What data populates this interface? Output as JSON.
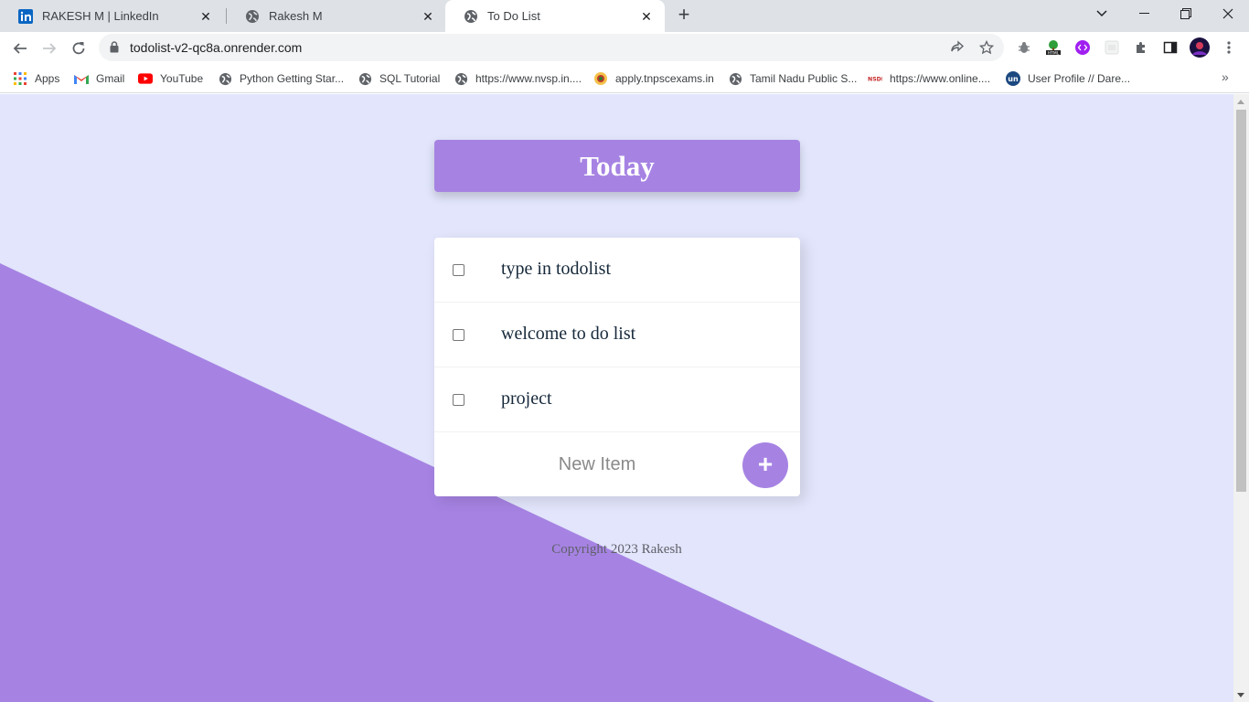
{
  "browser": {
    "tabs": [
      {
        "label": "RAKESH M | LinkedIn",
        "icon": "linkedin-icon"
      },
      {
        "label": "Rakesh M",
        "icon": "globe-icon"
      },
      {
        "label": "To Do List",
        "icon": "globe-icon",
        "active": true
      }
    ],
    "address": "todolist-v2-qc8a.onrender.com",
    "bookmarks": [
      {
        "label": "Apps",
        "icon": "apps-grid-icon"
      },
      {
        "label": "Gmail",
        "icon": "gmail-icon"
      },
      {
        "label": "YouTube",
        "icon": "youtube-icon"
      },
      {
        "label": "Python Getting Star...",
        "icon": "globe-icon"
      },
      {
        "label": "SQL Tutorial",
        "icon": "globe-icon"
      },
      {
        "label": "https://www.nvsp.in....",
        "icon": "globe-icon"
      },
      {
        "label": "apply.tnpscexams.in",
        "icon": "emblem-icon"
      },
      {
        "label": "Tamil Nadu Public S...",
        "icon": "globe-icon"
      },
      {
        "label": "https://www.online....",
        "icon": "nsdl-icon"
      },
      {
        "label": "User Profile // Dare...",
        "icon": "unstop-icon"
      }
    ]
  },
  "page": {
    "heading": "Today",
    "items": [
      {
        "label": "type in todolist",
        "checked": false
      },
      {
        "label": "welcome to do list",
        "checked": false
      },
      {
        "label": "project",
        "checked": false
      }
    ],
    "new_item_placeholder": "New Item",
    "add_button_label": "+",
    "footer": "Copyright 2023 Rakesh"
  },
  "colors": {
    "accent": "#a683e3",
    "page_background": "#e2e5fb",
    "text": "#17293b"
  }
}
